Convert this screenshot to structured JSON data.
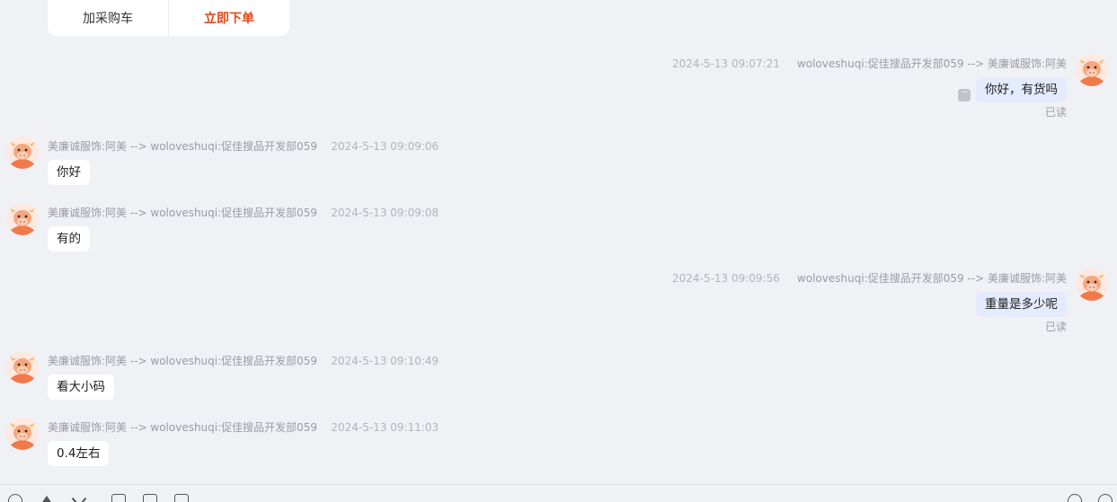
{
  "product_card": {
    "add_to_cart_label": "加采购车",
    "order_now_label": "立即下单"
  },
  "messages": [
    {
      "direction": "out",
      "time": "2024-5-13 09:07:21",
      "route": "woloveshuqi:促佳搜品开发部059 --> 美廉诚服饰:阿美",
      "text": "你好，有货吗",
      "status": "已读"
    },
    {
      "direction": "in",
      "route": "美廉诚服饰:阿美 --> woloveshuqi:促佳搜品开发部059",
      "time": "2024-5-13 09:09:06",
      "text": "你好"
    },
    {
      "direction": "in",
      "route": "美廉诚服饰:阿美 --> woloveshuqi:促佳搜品开发部059",
      "time": "2024-5-13 09:09:08",
      "text": "有的"
    },
    {
      "direction": "out",
      "time": "2024-5-13 09:09:56",
      "route": "woloveshuqi:促佳搜品开发部059 --> 美廉诚服饰:阿美",
      "text": "重量是多少呢",
      "status": "已读"
    },
    {
      "direction": "in",
      "route": "美廉诚服饰:阿美 --> woloveshuqi:促佳搜品开发部059",
      "time": "2024-5-13 09:10:49",
      "text": "看大小码"
    },
    {
      "direction": "in",
      "route": "美廉诚服饰:阿美 --> woloveshuqi:促佳搜品开发部059",
      "time": "2024-5-13 09:11:03",
      "text": "0.4左右"
    }
  ],
  "more_icon": "more-options-icon",
  "toolbar_icons": [
    "emoji-icon",
    "font-icon",
    "screenshot-icon",
    "image-icon",
    "file-icon",
    "product-icon",
    "add-icon",
    "quick-reply-icon"
  ],
  "colors": {
    "background": "#f0f1f5",
    "order_accent": "#e04a1a",
    "outgoing_bubble": "#e3ebfd",
    "incoming_bubble": "#ffffff",
    "avatar_orange": "#f07a4a"
  }
}
